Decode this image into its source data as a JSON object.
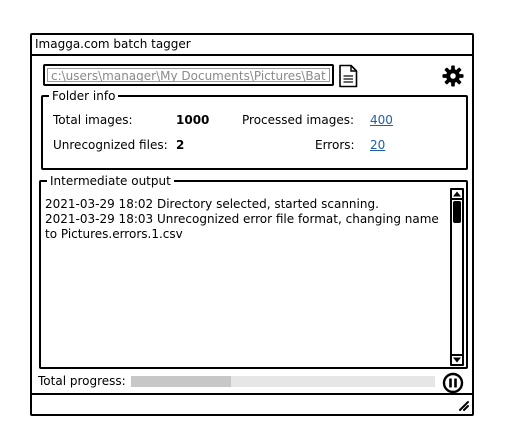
{
  "window": {
    "title": "Imagga.com batch tagger"
  },
  "toolbar": {
    "path_value": "c:\\users\\manager\\My Documents\\Pictures\\Bat",
    "browse_icon": "file-icon",
    "settings_icon": "gear-icon"
  },
  "folder_info": {
    "legend": "Folder info",
    "total_images_label": "Total images:",
    "total_images_value": "1000",
    "processed_label": "Processed images:",
    "processed_value": "400",
    "unrecognized_label": "Unrecognized files:",
    "unrecognized_value": "2",
    "errors_label": "Errors:",
    "errors_value": "20"
  },
  "output": {
    "legend": "Intermediate output",
    "log_text": "2021-03-29 18:02 Directory selected, started scanning.\n2021-03-29 18:03 Unrecognized error file format, changing name to Pictures.errors.1.csv"
  },
  "progress": {
    "label": "Total progress:",
    "fraction": 0.33,
    "pause_icon": "pause-icon"
  },
  "colors": {
    "link": "#1f5fa8",
    "progress_track": "#e6e6e6",
    "progress_fill": "#c7c7c7"
  }
}
